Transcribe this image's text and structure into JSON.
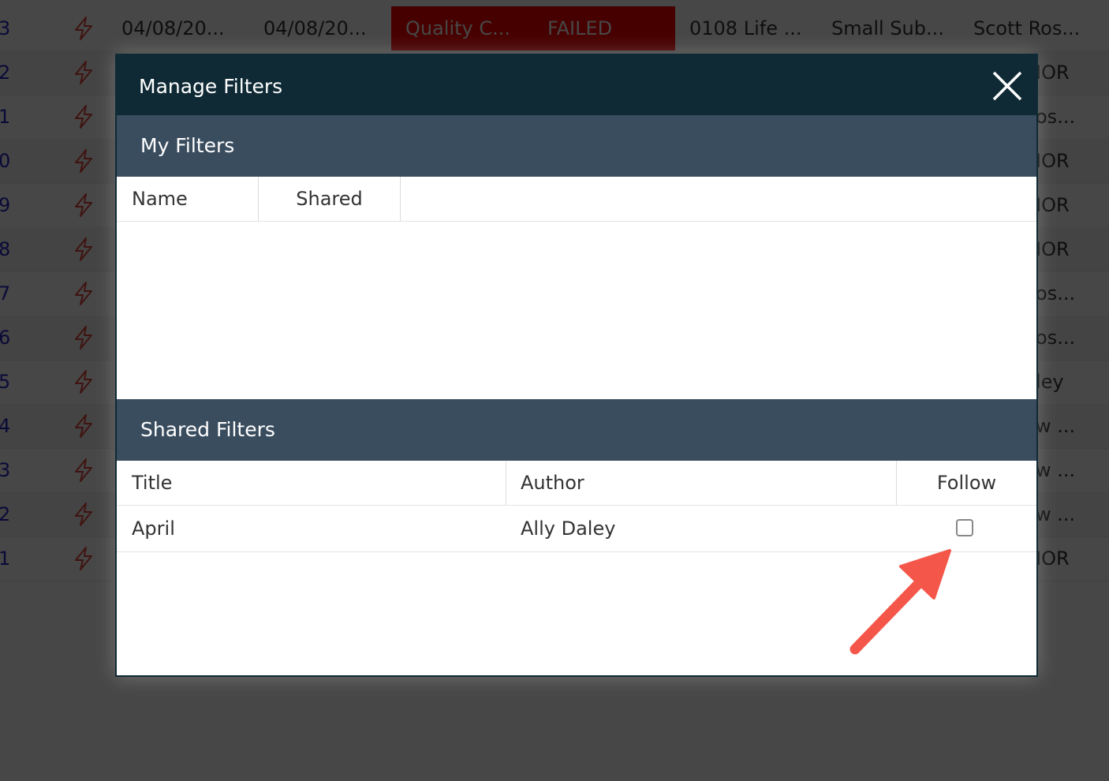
{
  "background": {
    "rows": [
      {
        "num": "3",
        "c1": "04/08/20...",
        "c2": "04/08/20...",
        "status_name": "Quality C...",
        "status": "FAILED",
        "c4": "0108 Life ...",
        "c5": "Small Sub...",
        "c6": "Scott Ros..."
      },
      {
        "num": "2",
        "c6": "IOR"
      },
      {
        "num": "1",
        "c6": "os..."
      },
      {
        "num": "0",
        "c6": "IOR"
      },
      {
        "num": "9",
        "c6": "IOR"
      },
      {
        "num": "8",
        "c6": "IOR"
      },
      {
        "num": "7",
        "c6": "os..."
      },
      {
        "num": "6",
        "c6": "os..."
      },
      {
        "num": "5",
        "c6": "ley"
      },
      {
        "num": "4",
        "c6": "w ..."
      },
      {
        "num": "3",
        "c6": "w ..."
      },
      {
        "num": "2",
        "c6": "w ..."
      },
      {
        "num": "1",
        "c6": "IOR"
      }
    ],
    "bolt_icon": "lightning-bolt-icon",
    "status_color": "#ff0000",
    "link_color": "#2424c8"
  },
  "modal": {
    "title": "Manage Filters",
    "close_icon": "close-icon",
    "header_color": "#0f2a35",
    "section_color": "#3a4d5e",
    "my_filters": {
      "title": "My Filters",
      "columns": {
        "name": "Name",
        "shared": "Shared"
      }
    },
    "shared_filters": {
      "title": "Shared Filters",
      "columns": {
        "title": "Title",
        "author": "Author",
        "follow": "Follow"
      },
      "rows": [
        {
          "title": "April",
          "author": "Ally Daley",
          "follow": false
        }
      ]
    }
  },
  "annotation": {
    "arrow_color": "#f4574a"
  }
}
